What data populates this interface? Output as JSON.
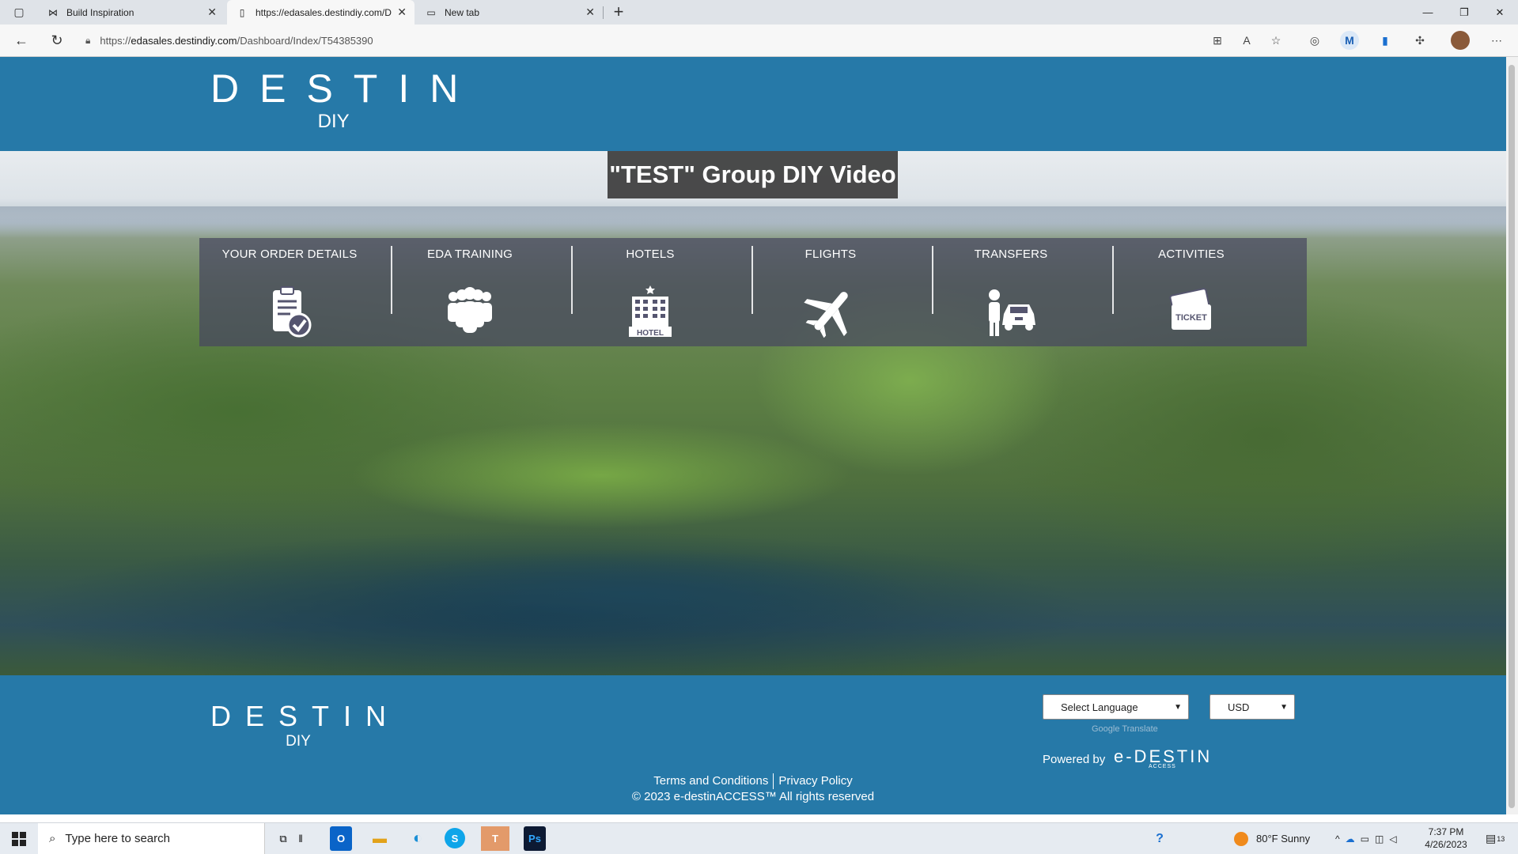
{
  "browser": {
    "tabs": [
      {
        "title": "Build Inspiration",
        "icon": "bowtie-icon"
      },
      {
        "title": "https://edasales.destindiy.com/D",
        "icon": "page-icon"
      },
      {
        "title": "New tab",
        "icon": "newtab-icon"
      }
    ],
    "url_prefix": "https://",
    "url_host": "edasales.destindiy.com",
    "url_path": "/Dashboard/Index/T54385390"
  },
  "header": {
    "logo_word": "DESTIN",
    "logo_sub": "DIY"
  },
  "hero": {
    "title": "\"TEST\" Group DIY Video"
  },
  "menu": [
    {
      "label": "YOUR ORDER DETAILS",
      "icon": "clipboard-check-icon"
    },
    {
      "label": "EDA TRAINING",
      "icon": "people-group-icon"
    },
    {
      "label": "HOTELS",
      "icon": "hotel-icon",
      "icon_text": "HOTEL"
    },
    {
      "label": "FLIGHTS",
      "icon": "airplane-icon"
    },
    {
      "label": "TRANSFERS",
      "icon": "driver-car-icon"
    },
    {
      "label": "ACTIVITIES",
      "icon": "ticket-icon",
      "icon_text": "TICKET"
    }
  ],
  "footer": {
    "logo_word": "DESTIN",
    "logo_sub": "DIY",
    "language_select": "Select Language",
    "currency_select": "USD",
    "google_translate": "Google Translate",
    "powered_by": "Powered by",
    "powered_logo": "e-DESTIN",
    "powered_logo_sub": "ACCESS",
    "terms": "Terms and Conditions",
    "privacy": "Privacy Policy",
    "copyright": "© 2023 e-destinACCESS™ All rights reserved"
  },
  "taskbar": {
    "search_placeholder": "Type here to search",
    "weather": "80°F  Sunny",
    "time": "7:37 PM",
    "date": "4/26/2023",
    "notifications": "13"
  },
  "colors": {
    "brand_blue": "#2679a8",
    "menu_overlay": "#46465f"
  }
}
